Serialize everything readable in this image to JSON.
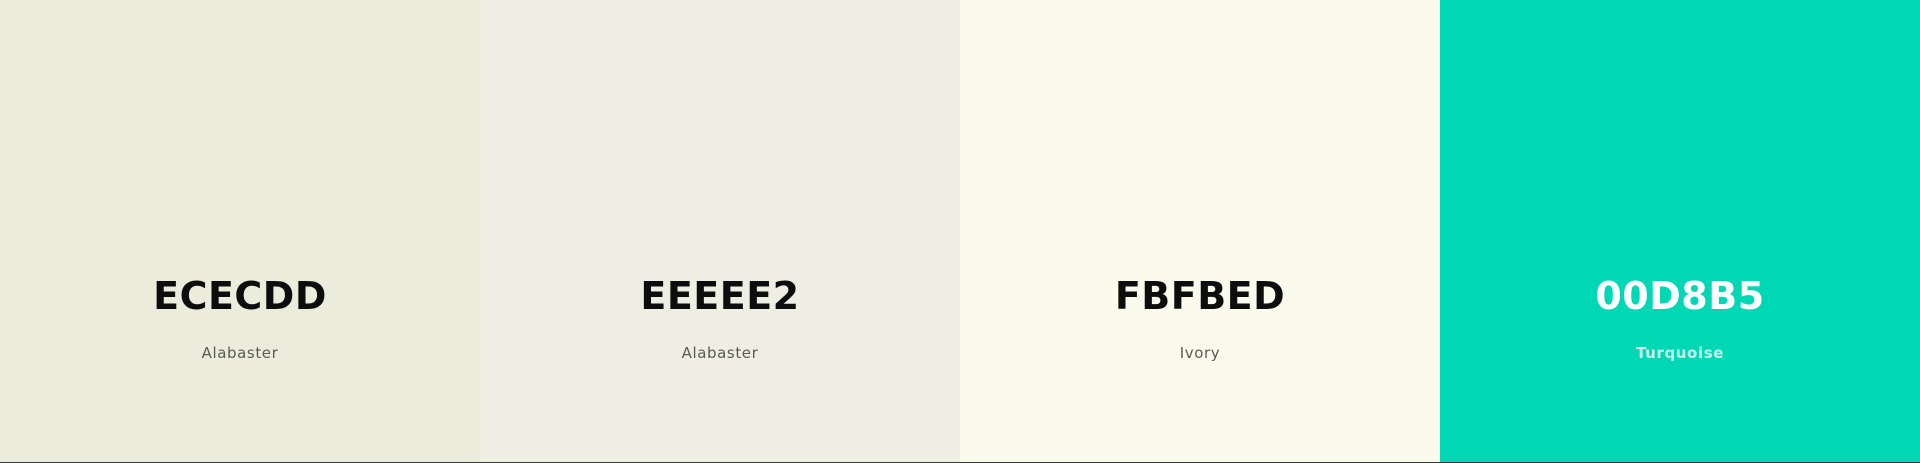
{
  "palette": {
    "swatches": [
      {
        "hex": "ECECDD",
        "name": "Alabaster",
        "color": "#ECECDD"
      },
      {
        "hex": "EEEEE2",
        "name": "Alabaster",
        "color": "#EEEEE2"
      },
      {
        "hex": "FBFBED",
        "name": "Ivory",
        "color": "#FBFBED"
      },
      {
        "hex": "00D8B5",
        "name": "Turquoise",
        "color": "#00D8B5"
      }
    ]
  }
}
